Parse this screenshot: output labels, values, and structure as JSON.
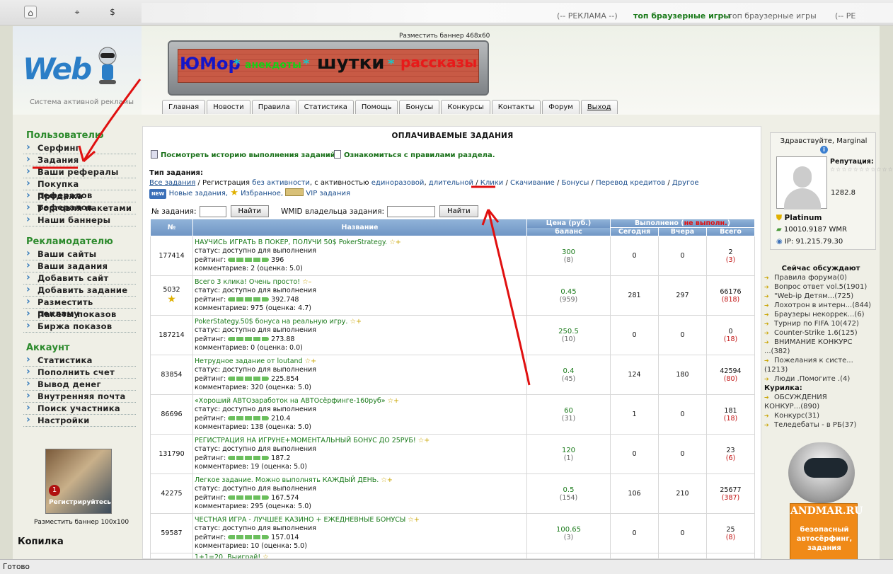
{
  "browser": {
    "ad_prefix": "(-- РЕКЛАМА --)",
    "ad_link": "топ браузерные игры",
    "ad_text": " - топ браузерные игры",
    "ad_suffix": "(-- РЕ",
    "status": "Готово"
  },
  "header": {
    "logo_subtitle": "Система активной рекламы",
    "banner_caption": "Разместить баннер 468x60",
    "banner_words": [
      "ЮМор",
      "*",
      "анекдоты",
      "*",
      "шутки",
      "*",
      "рассказы"
    ]
  },
  "nav_tabs": [
    "Главная",
    "Новости",
    "Правила",
    "Статистика",
    "Помощь",
    "Бонусы",
    "Конкурсы",
    "Контакты",
    "Форум",
    "Выход"
  ],
  "sidebar": {
    "user_title": "Пользователю",
    "user_items": [
      "Серфинг",
      "Задания",
      "Ваши рефералы",
      "Покупка рефералов",
      "Продажа рефералов",
      "Торговля пакетами",
      "Наши баннеры"
    ],
    "adv_title": "Рекламодателю",
    "adv_items": [
      "Ваши сайты",
      "Ваши задания",
      "Добавить сайт",
      "Добавить задание",
      "Разместить рекламу",
      "Пакеты показов",
      "Биржа показов"
    ],
    "acc_title": "Аккаунт",
    "acc_items": [
      "Статистика",
      "Пополнить счет",
      "Вывод денег",
      "Внутренняя почта",
      "Поиск участника",
      "Настройки"
    ],
    "promo_badge": "1",
    "promo_text": "Регистрируйтесь",
    "banner_caption": "Разместить баннер 100x100",
    "kopilka": "Копилка"
  },
  "main": {
    "title": "ОПЛАЧИВАЕМЫЕ ЗАДАНИЯ",
    "history_link": "Посмотреть историю выполнения заданий.",
    "rules_link": "Ознакомиться с правилами раздела.",
    "types_label": "Тип задания:",
    "types_line1_a": "Все задания",
    "types_line1_b": " / Регистрация ",
    "types_line1_c": "без активности",
    "types_line1_d": ", с активностью ",
    "types_line1_e": "единоразовой",
    "types_line1_f": ", ",
    "types_line1_g": "длительной",
    "types_line1_h": " / ",
    "types_links": [
      "Клики",
      "Скачивание",
      "Бонусы",
      "Перевод кредитов",
      "Другое"
    ],
    "new_badge": "NEW",
    "new_tasks": "Новые задания,",
    "favorites": "Избранное,",
    "vip_tasks": "VIP задания",
    "task_no_label": "№ задания:",
    "wmid_label": "WMID владельца задания:",
    "find_button": "Найти",
    "find_button2": "Найти",
    "col_num": "№",
    "col_name": "Название",
    "col_price": "Цена (руб.)",
    "col_balance": "баланс",
    "col_done_pre": "Выполнено (",
    "col_done_red": "не выполн.",
    "col_done_post": ")",
    "col_today": "Сегодня",
    "col_yesterday": "Вчера",
    "col_total": "Всего",
    "status_label": "статус: доступно для выполнения",
    "rating_label": "рейтинг:",
    "rows": [
      {
        "id": "177414",
        "title": "НАУЧИСЬ ИГРАТЬ В ПОКЕР, ПОЛУЧИ 50$ PokerStrategy.",
        "rating": "396",
        "comments": "комментариев: 2 (оценка: 5.0)",
        "price": "300",
        "balance": "(8)",
        "today": "0",
        "yesterday": "0",
        "total": "2",
        "fail": "(3)"
      },
      {
        "id": "5032",
        "title": "Всего 3 клика! Очень просто!",
        "rating": "392.748",
        "comments": "комментариев: 975 (оценка: 4.7)",
        "price": "0.45",
        "balance": "(959)",
        "today": "281",
        "yesterday": "297",
        "total": "66176",
        "fail": "(818)"
      },
      {
        "id": "187214",
        "title": "PokerStategy.50$ бонуса на реальную игру.",
        "rating": "273.88",
        "comments": "комментариев: 0 (оценка: 0.0)",
        "price": "250.5",
        "balance": "(10)",
        "today": "0",
        "yesterday": "0",
        "total": "0",
        "fail": "(18)"
      },
      {
        "id": "83854",
        "title": "Нетрудное задание от loutand",
        "rating": "225.854",
        "comments": "комментариев: 320 (оценка: 5.0)",
        "price": "0.4",
        "balance": "(45)",
        "today": "124",
        "yesterday": "180",
        "total": "42594",
        "fail": "(80)"
      },
      {
        "id": "86696",
        "title": "«Хороший АВТОзаработок на АВТОсёрфинге-160руб»",
        "rating": "210.4",
        "comments": "комментариев: 138 (оценка: 5.0)",
        "price": "60",
        "balance": "(31)",
        "today": "1",
        "yesterday": "0",
        "total": "181",
        "fail": "(18)"
      },
      {
        "id": "131790",
        "title": "РЕГИСТРАЦИЯ НА ИГРУНЕ+МОМЕНТАЛЬНЫЙ БОНУС ДО 25РУБ!",
        "rating": "187.2",
        "comments": "комментариев: 19 (оценка: 5.0)",
        "price": "120",
        "balance": "(1)",
        "today": "0",
        "yesterday": "0",
        "total": "23",
        "fail": "(6)"
      },
      {
        "id": "42275",
        "title": "Легкое задание. Можно выполнять КАЖДЫЙ ДЕНЬ.",
        "rating": "167.574",
        "comments": "комментариев: 295 (оценка: 5.0)",
        "price": "0.5",
        "balance": "(154)",
        "today": "106",
        "yesterday": "210",
        "total": "25677",
        "fail": "(387)"
      },
      {
        "id": "59587",
        "title": "ЧЕСТНАЯ ИГРА - ЛУЧШЕЕ КАЗИНО + ЕЖЕДНЕВНЫЕ БОНУСЫ",
        "rating": "157.014",
        "comments": "комментариев: 10 (оценка: 5.0)",
        "price": "100.65",
        "balance": "(3)",
        "today": "0",
        "yesterday": "0",
        "total": "25",
        "fail": "(8)"
      }
    ],
    "last_row_title": "1+1=20. Выиграй!"
  },
  "user_panel": {
    "greeting": "Здравствуйте, Marginal",
    "reputation_label": "Репутация:",
    "reputation_value": "1282.8",
    "level": "Platinum",
    "balance": "10010.9187 WMR",
    "ip": "IP: 91.215.79.30"
  },
  "forum": {
    "title": "Сейчас обсуждают",
    "items": [
      "Правила форума(0)",
      "Вопрос ответ vol.5(1901)",
      "\"Web-ip Детям...(725)",
      "Лохотрон в интерн...(844)",
      "Браузеры некоррек...(6)",
      "Турнир по FIFA 10(472)",
      "Counter-Strike 1.6(125)",
      "ВНИМАНИЕ КОНКУРС"
    ],
    "item_cont": "...(382)",
    "item9": "Пожелания к систе...",
    "item9_cont": "(1213)",
    "item10": "Люди .Помогите .(4)",
    "kurilka_title": "Курилка:",
    "kurilka_items": [
      "ОБСУЖДЕНИЯ",
      "Конкурс(31)",
      "Теледебаты - в РБ(37)"
    ],
    "kurilka_cont": "КОНКУР...(890)"
  },
  "andmar": {
    "title": "ANDMAR.RU",
    "text": "безопасный автосёрфинг, задания"
  },
  "colors": {
    "accent_green": "#2c8a2c",
    "table_header": "#7aa0cc",
    "annotation": "#e01010"
  }
}
